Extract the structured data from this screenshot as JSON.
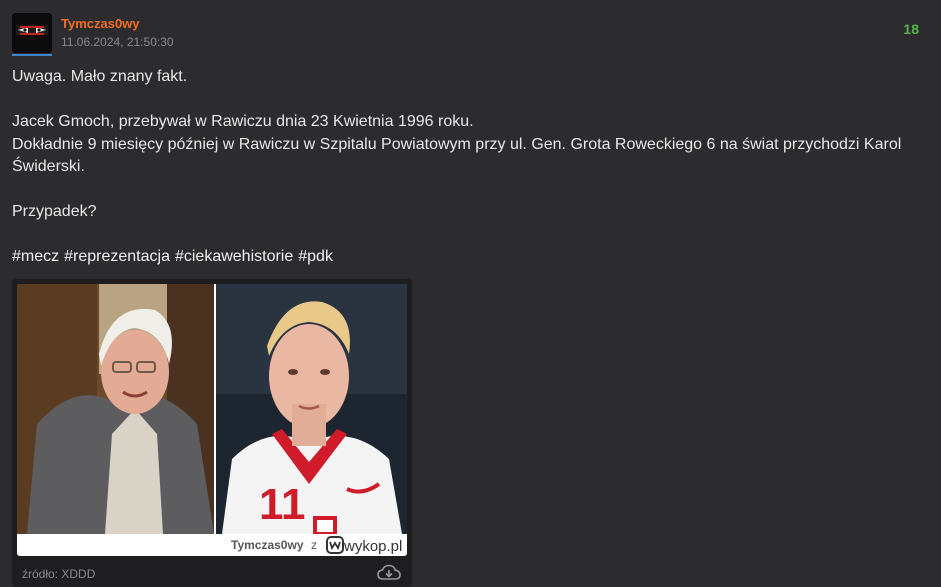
{
  "post": {
    "username": "Tymczas0wy",
    "timestamp": "11.06.2024, 21:50:30",
    "votes": "18",
    "lines": {
      "l1": "Uwaga. Mało znany fakt.",
      "l2": "Jacek Gmoch, przebywał w Rawiczu dnia 23 Kwietnia 1996 roku.",
      "l3": "Dokładnie 9 miesięcy później w Rawiczu w Szpitalu Powiatowym przy ul. Gen. Grota Roweckiego 6 na świat przychodzi Karol Świderski.",
      "l4": "Przypadek?"
    },
    "tags": [
      "#mecz",
      "#reprezentacja",
      "#ciekawehistorie",
      "#pdk"
    ]
  },
  "embed": {
    "caption_user": "Tymczas0wy",
    "caption_z": "z",
    "caption_brand": "wykop.pl",
    "source_label": "źródło: XDDD"
  },
  "icons": {
    "avatar": "ninja-avatar-icon",
    "download": "cloud-download-icon"
  },
  "colors": {
    "username": "#f26d21",
    "votes": "#55b54a",
    "background": "#2c2c2e"
  }
}
